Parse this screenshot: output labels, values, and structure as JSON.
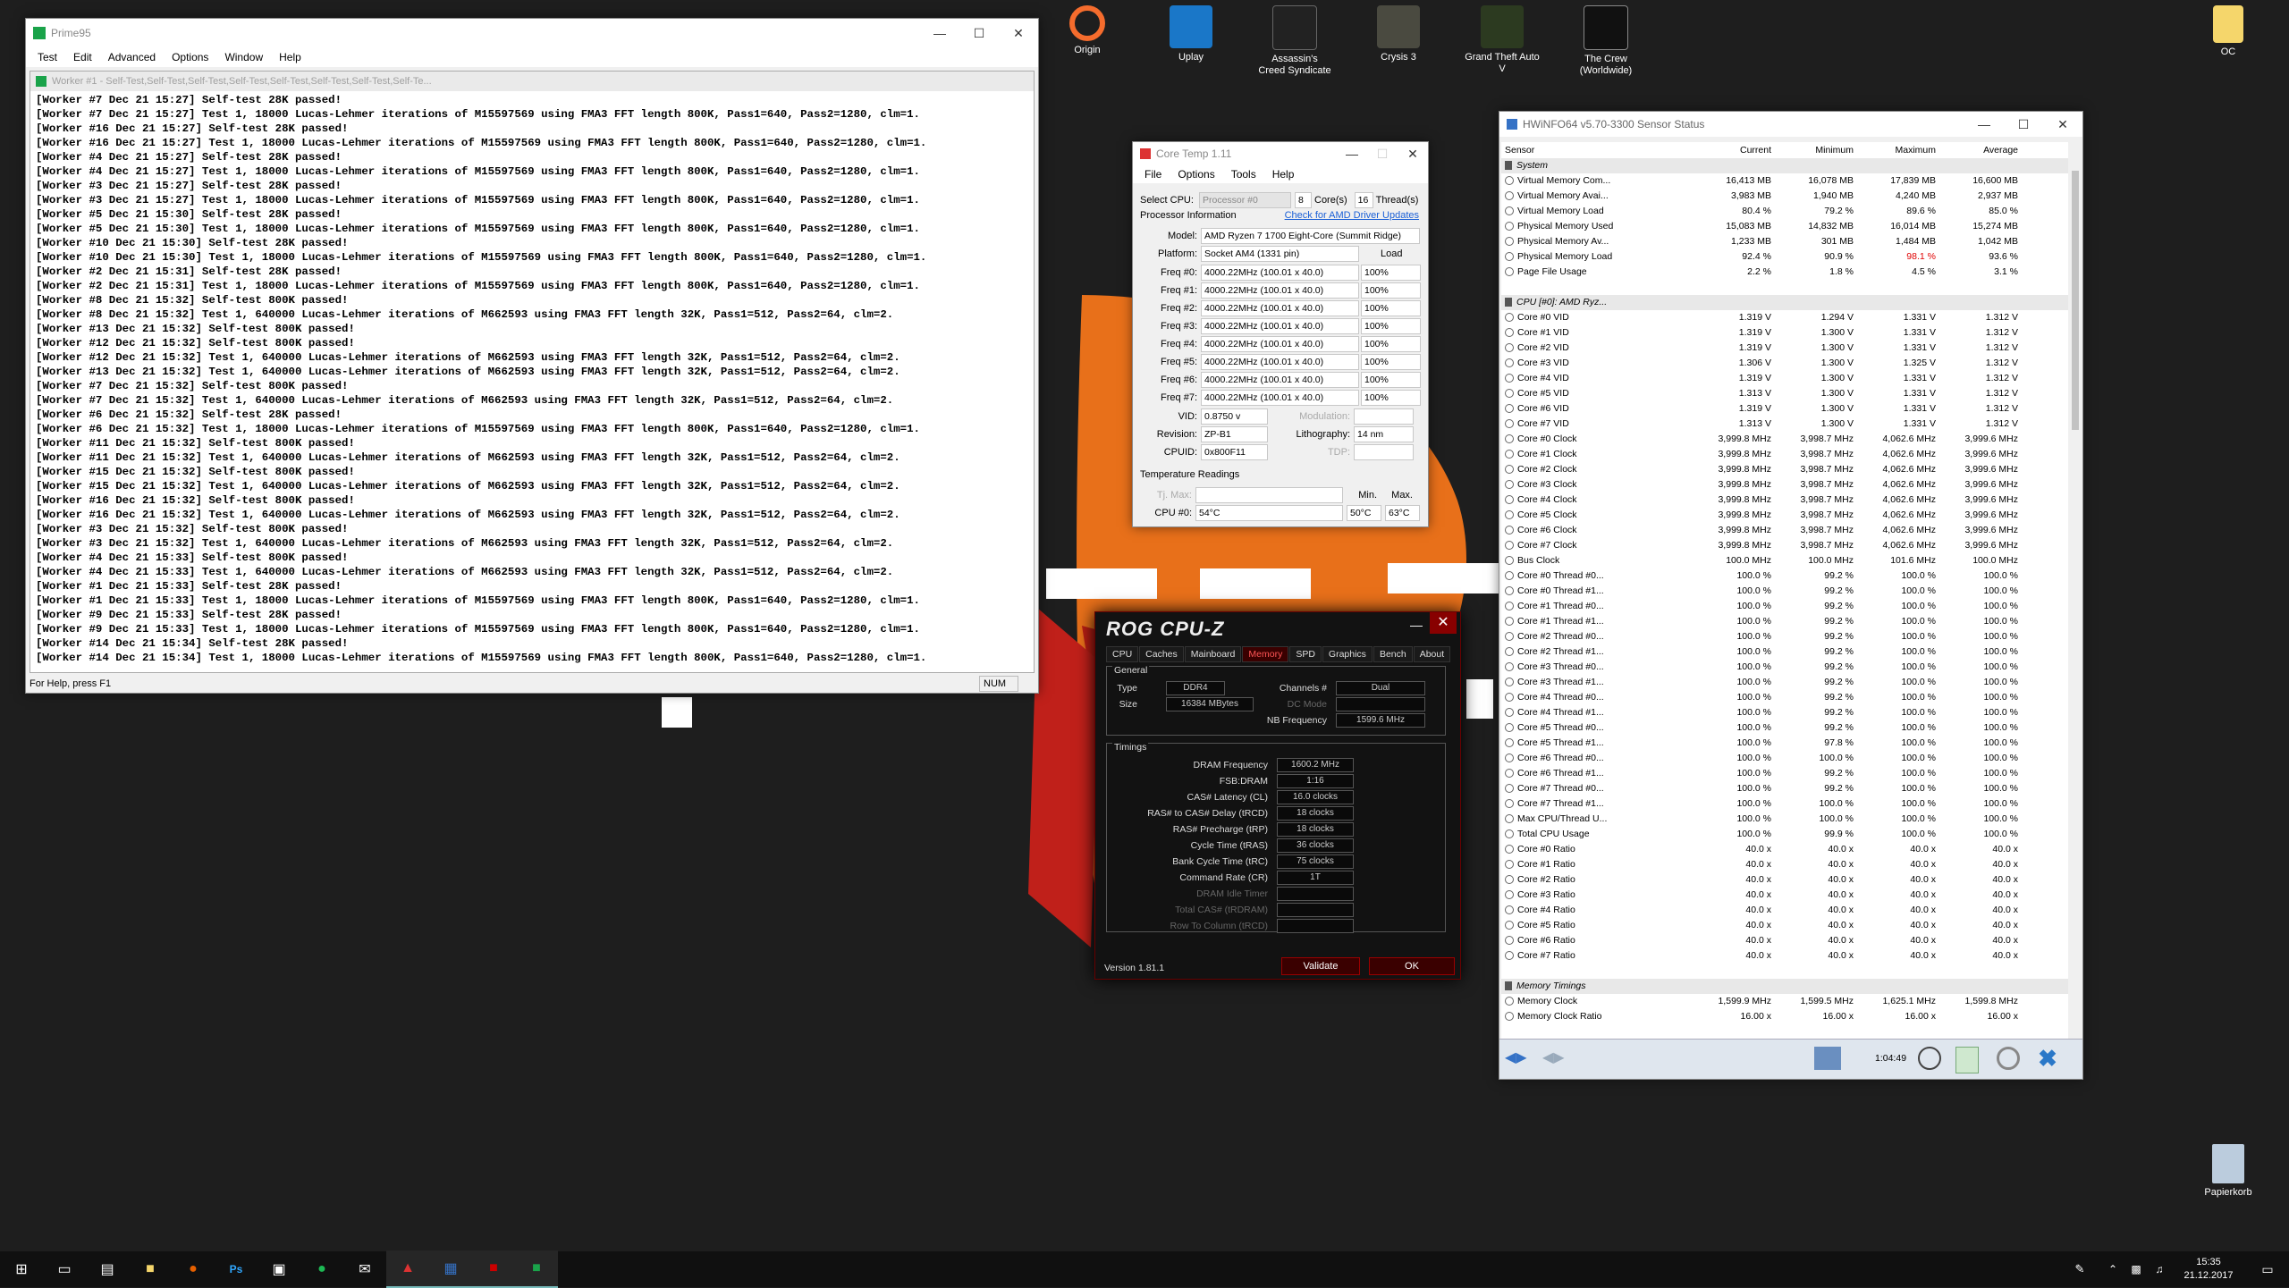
{
  "desktop": {
    "icons": [
      {
        "label": "Origin"
      },
      {
        "label": "Uplay"
      },
      {
        "label": "Assassin's Creed Syndicate"
      },
      {
        "label": "Crysis 3"
      },
      {
        "label": "Grand Theft Auto V"
      },
      {
        "label": "The Crew (Worldwide)"
      },
      {
        "label": "OC"
      },
      {
        "label": "Papierkorb"
      }
    ]
  },
  "prime": {
    "title": "Prime95",
    "menu": [
      "Test",
      "Edit",
      "Advanced",
      "Options",
      "Window",
      "Help"
    ],
    "child_title": "Worker #1 - Self-Test,Self-Test,Self-Test,Self-Test,Self-Test,Self-Test,Self-Test,Self-Te...",
    "log": [
      "[Worker #7 Dec 21 15:27] Self-test 28K passed!",
      "[Worker #7 Dec 21 15:27] Test 1, 18000 Lucas-Lehmer iterations of M15597569 using FMA3 FFT length 800K, Pass1=640, Pass2=1280, clm=1.",
      "[Worker #16 Dec 21 15:27] Self-test 28K passed!",
      "[Worker #16 Dec 21 15:27] Test 1, 18000 Lucas-Lehmer iterations of M15597569 using FMA3 FFT length 800K, Pass1=640, Pass2=1280, clm=1.",
      "[Worker #4 Dec 21 15:27] Self-test 28K passed!",
      "[Worker #4 Dec 21 15:27] Test 1, 18000 Lucas-Lehmer iterations of M15597569 using FMA3 FFT length 800K, Pass1=640, Pass2=1280, clm=1.",
      "[Worker #3 Dec 21 15:27] Self-test 28K passed!",
      "[Worker #3 Dec 21 15:27] Test 1, 18000 Lucas-Lehmer iterations of M15597569 using FMA3 FFT length 800K, Pass1=640, Pass2=1280, clm=1.",
      "[Worker #5 Dec 21 15:30] Self-test 28K passed!",
      "[Worker #5 Dec 21 15:30] Test 1, 18000 Lucas-Lehmer iterations of M15597569 using FMA3 FFT length 800K, Pass1=640, Pass2=1280, clm=1.",
      "[Worker #10 Dec 21 15:30] Self-test 28K passed!",
      "[Worker #10 Dec 21 15:30] Test 1, 18000 Lucas-Lehmer iterations of M15597569 using FMA3 FFT length 800K, Pass1=640, Pass2=1280, clm=1.",
      "[Worker #2 Dec 21 15:31] Self-test 28K passed!",
      "[Worker #2 Dec 21 15:31] Test 1, 18000 Lucas-Lehmer iterations of M15597569 using FMA3 FFT length 800K, Pass1=640, Pass2=1280, clm=1.",
      "[Worker #8 Dec 21 15:32] Self-test 800K passed!",
      "[Worker #8 Dec 21 15:32] Test 1, 640000 Lucas-Lehmer iterations of M662593 using FMA3 FFT length 32K, Pass1=512, Pass2=64, clm=2.",
      "[Worker #13 Dec 21 15:32] Self-test 800K passed!",
      "[Worker #12 Dec 21 15:32] Self-test 800K passed!",
      "[Worker #12 Dec 21 15:32] Test 1, 640000 Lucas-Lehmer iterations of M662593 using FMA3 FFT length 32K, Pass1=512, Pass2=64, clm=2.",
      "[Worker #13 Dec 21 15:32] Test 1, 640000 Lucas-Lehmer iterations of M662593 using FMA3 FFT length 32K, Pass1=512, Pass2=64, clm=2.",
      "[Worker #7 Dec 21 15:32] Self-test 800K passed!",
      "[Worker #7 Dec 21 15:32] Test 1, 640000 Lucas-Lehmer iterations of M662593 using FMA3 FFT length 32K, Pass1=512, Pass2=64, clm=2.",
      "[Worker #6 Dec 21 15:32] Self-test 28K passed!",
      "[Worker #6 Dec 21 15:32] Test 1, 18000 Lucas-Lehmer iterations of M15597569 using FMA3 FFT length 800K, Pass1=640, Pass2=1280, clm=1.",
      "[Worker #11 Dec 21 15:32] Self-test 800K passed!",
      "[Worker #11 Dec 21 15:32] Test 1, 640000 Lucas-Lehmer iterations of M662593 using FMA3 FFT length 32K, Pass1=512, Pass2=64, clm=2.",
      "[Worker #15 Dec 21 15:32] Self-test 800K passed!",
      "[Worker #15 Dec 21 15:32] Test 1, 640000 Lucas-Lehmer iterations of M662593 using FMA3 FFT length 32K, Pass1=512, Pass2=64, clm=2.",
      "[Worker #16 Dec 21 15:32] Self-test 800K passed!",
      "[Worker #16 Dec 21 15:32] Test 1, 640000 Lucas-Lehmer iterations of M662593 using FMA3 FFT length 32K, Pass1=512, Pass2=64, clm=2.",
      "[Worker #3 Dec 21 15:32] Self-test 800K passed!",
      "[Worker #3 Dec 21 15:32] Test 1, 640000 Lucas-Lehmer iterations of M662593 using FMA3 FFT length 32K, Pass1=512, Pass2=64, clm=2.",
      "[Worker #4 Dec 21 15:33] Self-test 800K passed!",
      "[Worker #4 Dec 21 15:33] Test 1, 640000 Lucas-Lehmer iterations of M662593 using FMA3 FFT length 32K, Pass1=512, Pass2=64, clm=2.",
      "[Worker #1 Dec 21 15:33] Self-test 28K passed!",
      "[Worker #1 Dec 21 15:33] Test 1, 18000 Lucas-Lehmer iterations of M15597569 using FMA3 FFT length 800K, Pass1=640, Pass2=1280, clm=1.",
      "[Worker #9 Dec 21 15:33] Self-test 28K passed!",
      "[Worker #9 Dec 21 15:33] Test 1, 18000 Lucas-Lehmer iterations of M15597569 using FMA3 FFT length 800K, Pass1=640, Pass2=1280, clm=1.",
      "[Worker #14 Dec 21 15:34] Self-test 28K passed!",
      "[Worker #14 Dec 21 15:34] Test 1, 18000 Lucas-Lehmer iterations of M15597569 using FMA3 FFT length 800K, Pass1=640, Pass2=1280, clm=1."
    ],
    "status_left": "For Help, press F1",
    "status_num": "NUM"
  },
  "coretemp": {
    "title": "Core Temp 1.11",
    "menu": [
      "File",
      "Options",
      "Tools",
      "Help"
    ],
    "select_cpu_label": "Select CPU:",
    "select_cpu_value": "Processor #0",
    "cores_value": "8",
    "cores_label": "Core(s)",
    "threads_value": "16",
    "threads_label": "Thread(s)",
    "proc_info_label": "Processor Information",
    "driver_link": "Check for AMD Driver Updates",
    "model_label": "Model:",
    "model_value": "AMD Ryzen 7 1700 Eight-Core (Summit Ridge)",
    "platform_label": "Platform:",
    "platform_value": "Socket AM4 (1331 pin)",
    "load_label": "Load",
    "freqs": [
      {
        "label": "Freq #0:",
        "value": "4000.22MHz (100.01 x 40.0)",
        "load": "100%"
      },
      {
        "label": "Freq #1:",
        "value": "4000.22MHz (100.01 x 40.0)",
        "load": "100%"
      },
      {
        "label": "Freq #2:",
        "value": "4000.22MHz (100.01 x 40.0)",
        "load": "100%"
      },
      {
        "label": "Freq #3:",
        "value": "4000.22MHz (100.01 x 40.0)",
        "load": "100%"
      },
      {
        "label": "Freq #4:",
        "value": "4000.22MHz (100.01 x 40.0)",
        "load": "100%"
      },
      {
        "label": "Freq #5:",
        "value": "4000.22MHz (100.01 x 40.0)",
        "load": "100%"
      },
      {
        "label": "Freq #6:",
        "value": "4000.22MHz (100.01 x 40.0)",
        "load": "100%"
      },
      {
        "label": "Freq #7:",
        "value": "4000.22MHz (100.01 x 40.0)",
        "load": "100%"
      }
    ],
    "vid_label": "VID:",
    "vid_value": "0.8750 v",
    "modulation_label": "Modulation:",
    "revision_label": "Revision:",
    "revision_value": "ZP-B1",
    "litho_label": "Lithography:",
    "litho_value": "14 nm",
    "cpuid_label": "CPUID:",
    "cpuid_value": "0x800F11",
    "tdp_label": "TDP:",
    "temp_title": "Temperature Readings",
    "tjmax_label": "Tj. Max:",
    "min_label": "Min.",
    "max_label": "Max.",
    "cpu0_label": "CPU #0:",
    "cpu0_value": "54°C",
    "cpu0_min": "50°C",
    "cpu0_max": "63°C"
  },
  "cpuz": {
    "title": "ROG CPU-Z",
    "tabs": [
      "CPU",
      "Caches",
      "Mainboard",
      "Memory",
      "SPD",
      "Graphics",
      "Bench",
      "About"
    ],
    "selected_tab": "Memory",
    "general_label": "General",
    "type_label": "Type",
    "type_value": "DDR4",
    "size_label": "Size",
    "size_value": "16384 MBytes",
    "channels_label": "Channels #",
    "channels_value": "Dual",
    "dcmode_label": "DC Mode",
    "nbfreq_label": "NB Frequency",
    "nbfreq_value": "1599.6 MHz",
    "timings_label": "Timings",
    "timings": [
      {
        "label": "DRAM Frequency",
        "value": "1600.2 MHz",
        "dim": false
      },
      {
        "label": "FSB:DRAM",
        "value": "1:16",
        "dim": false
      },
      {
        "label": "CAS# Latency (CL)",
        "value": "16.0 clocks",
        "dim": false
      },
      {
        "label": "RAS# to CAS# Delay (tRCD)",
        "value": "18 clocks",
        "dim": false
      },
      {
        "label": "RAS# Precharge (tRP)",
        "value": "18 clocks",
        "dim": false
      },
      {
        "label": "Cycle Time (tRAS)",
        "value": "36 clocks",
        "dim": false
      },
      {
        "label": "Bank Cycle Time (tRC)",
        "value": "75 clocks",
        "dim": false
      },
      {
        "label": "Command Rate (CR)",
        "value": "1T",
        "dim": false
      },
      {
        "label": "DRAM Idle Timer",
        "value": "",
        "dim": true
      },
      {
        "label": "Total CAS# (tRDRAM)",
        "value": "",
        "dim": true
      },
      {
        "label": "Row To Column (tRCD)",
        "value": "",
        "dim": true
      }
    ],
    "version": "Version 1.81.1",
    "validate": "Validate",
    "ok": "OK"
  },
  "hwinfo": {
    "title": "HWiNFO64 v5.70-3300 Sensor Status",
    "headers": [
      "Sensor",
      "Current",
      "Minimum",
      "Maximum",
      "Average"
    ],
    "rows": [
      {
        "group": true,
        "name": "System"
      },
      {
        "name": "Virtual Memory Com...",
        "cur": "16,413 MB",
        "min": "16,078 MB",
        "max": "17,839 MB",
        "avg": "16,600 MB"
      },
      {
        "name": "Virtual Memory Avai...",
        "cur": "3,983 MB",
        "min": "1,940 MB",
        "max": "4,240 MB",
        "avg": "2,937 MB"
      },
      {
        "name": "Virtual Memory Load",
        "cur": "80.4 %",
        "min": "79.2 %",
        "max": "89.6 %",
        "avg": "85.0 %"
      },
      {
        "name": "Physical Memory Used",
        "cur": "15,083 MB",
        "min": "14,832 MB",
        "max": "16,014 MB",
        "avg": "15,274 MB"
      },
      {
        "name": "Physical Memory Av...",
        "cur": "1,233 MB",
        "min": "301 MB",
        "max": "1,484 MB",
        "avg": "1,042 MB"
      },
      {
        "name": "Physical Memory Load",
        "cur": "92.4 %",
        "min": "90.9 %",
        "max": "98.1 %",
        "avg": "93.6 %",
        "red": true
      },
      {
        "name": "Page File Usage",
        "cur": "2.2 %",
        "min": "1.8 %",
        "max": "4.5 %",
        "avg": "3.1 %"
      },
      {
        "blank": true
      },
      {
        "group": true,
        "name": "CPU [#0]: AMD Ryz..."
      },
      {
        "name": "Core #0 VID",
        "cur": "1.319 V",
        "min": "1.294 V",
        "max": "1.331 V",
        "avg": "1.312 V"
      },
      {
        "name": "Core #1 VID",
        "cur": "1.319 V",
        "min": "1.300 V",
        "max": "1.331 V",
        "avg": "1.312 V"
      },
      {
        "name": "Core #2 VID",
        "cur": "1.319 V",
        "min": "1.300 V",
        "max": "1.331 V",
        "avg": "1.312 V"
      },
      {
        "name": "Core #3 VID",
        "cur": "1.306 V",
        "min": "1.300 V",
        "max": "1.325 V",
        "avg": "1.312 V"
      },
      {
        "name": "Core #4 VID",
        "cur": "1.319 V",
        "min": "1.300 V",
        "max": "1.331 V",
        "avg": "1.312 V"
      },
      {
        "name": "Core #5 VID",
        "cur": "1.313 V",
        "min": "1.300 V",
        "max": "1.331 V",
        "avg": "1.312 V"
      },
      {
        "name": "Core #6 VID",
        "cur": "1.319 V",
        "min": "1.300 V",
        "max": "1.331 V",
        "avg": "1.312 V"
      },
      {
        "name": "Core #7 VID",
        "cur": "1.313 V",
        "min": "1.300 V",
        "max": "1.331 V",
        "avg": "1.312 V"
      },
      {
        "name": "Core #0 Clock",
        "cur": "3,999.8 MHz",
        "min": "3,998.7 MHz",
        "max": "4,062.6 MHz",
        "avg": "3,999.6 MHz"
      },
      {
        "name": "Core #1 Clock",
        "cur": "3,999.8 MHz",
        "min": "3,998.7 MHz",
        "max": "4,062.6 MHz",
        "avg": "3,999.6 MHz"
      },
      {
        "name": "Core #2 Clock",
        "cur": "3,999.8 MHz",
        "min": "3,998.7 MHz",
        "max": "4,062.6 MHz",
        "avg": "3,999.6 MHz"
      },
      {
        "name": "Core #3 Clock",
        "cur": "3,999.8 MHz",
        "min": "3,998.7 MHz",
        "max": "4,062.6 MHz",
        "avg": "3,999.6 MHz"
      },
      {
        "name": "Core #4 Clock",
        "cur": "3,999.8 MHz",
        "min": "3,998.7 MHz",
        "max": "4,062.6 MHz",
        "avg": "3,999.6 MHz"
      },
      {
        "name": "Core #5 Clock",
        "cur": "3,999.8 MHz",
        "min": "3,998.7 MHz",
        "max": "4,062.6 MHz",
        "avg": "3,999.6 MHz"
      },
      {
        "name": "Core #6 Clock",
        "cur": "3,999.8 MHz",
        "min": "3,998.7 MHz",
        "max": "4,062.6 MHz",
        "avg": "3,999.6 MHz"
      },
      {
        "name": "Core #7 Clock",
        "cur": "3,999.8 MHz",
        "min": "3,998.7 MHz",
        "max": "4,062.6 MHz",
        "avg": "3,999.6 MHz"
      },
      {
        "name": "Bus Clock",
        "cur": "100.0 MHz",
        "min": "100.0 MHz",
        "max": "101.6 MHz",
        "avg": "100.0 MHz"
      },
      {
        "name": "Core #0 Thread #0...",
        "cur": "100.0 %",
        "min": "99.2 %",
        "max": "100.0 %",
        "avg": "100.0 %"
      },
      {
        "name": "Core #0 Thread #1...",
        "cur": "100.0 %",
        "min": "99.2 %",
        "max": "100.0 %",
        "avg": "100.0 %"
      },
      {
        "name": "Core #1 Thread #0...",
        "cur": "100.0 %",
        "min": "99.2 %",
        "max": "100.0 %",
        "avg": "100.0 %"
      },
      {
        "name": "Core #1 Thread #1...",
        "cur": "100.0 %",
        "min": "99.2 %",
        "max": "100.0 %",
        "avg": "100.0 %"
      },
      {
        "name": "Core #2 Thread #0...",
        "cur": "100.0 %",
        "min": "99.2 %",
        "max": "100.0 %",
        "avg": "100.0 %"
      },
      {
        "name": "Core #2 Thread #1...",
        "cur": "100.0 %",
        "min": "99.2 %",
        "max": "100.0 %",
        "avg": "100.0 %"
      },
      {
        "name": "Core #3 Thread #0...",
        "cur": "100.0 %",
        "min": "99.2 %",
        "max": "100.0 %",
        "avg": "100.0 %"
      },
      {
        "name": "Core #3 Thread #1...",
        "cur": "100.0 %",
        "min": "99.2 %",
        "max": "100.0 %",
        "avg": "100.0 %"
      },
      {
        "name": "Core #4 Thread #0...",
        "cur": "100.0 %",
        "min": "99.2 %",
        "max": "100.0 %",
        "avg": "100.0 %"
      },
      {
        "name": "Core #4 Thread #1...",
        "cur": "100.0 %",
        "min": "99.2 %",
        "max": "100.0 %",
        "avg": "100.0 %"
      },
      {
        "name": "Core #5 Thread #0...",
        "cur": "100.0 %",
        "min": "99.2 %",
        "max": "100.0 %",
        "avg": "100.0 %"
      },
      {
        "name": "Core #5 Thread #1...",
        "cur": "100.0 %",
        "min": "97.8 %",
        "max": "100.0 %",
        "avg": "100.0 %"
      },
      {
        "name": "Core #6 Thread #0...",
        "cur": "100.0 %",
        "min": "100.0 %",
        "max": "100.0 %",
        "avg": "100.0 %"
      },
      {
        "name": "Core #6 Thread #1...",
        "cur": "100.0 %",
        "min": "99.2 %",
        "max": "100.0 %",
        "avg": "100.0 %"
      },
      {
        "name": "Core #7 Thread #0...",
        "cur": "100.0 %",
        "min": "99.2 %",
        "max": "100.0 %",
        "avg": "100.0 %"
      },
      {
        "name": "Core #7 Thread #1...",
        "cur": "100.0 %",
        "min": "100.0 %",
        "max": "100.0 %",
        "avg": "100.0 %"
      },
      {
        "name": "Max CPU/Thread U...",
        "cur": "100.0 %",
        "min": "100.0 %",
        "max": "100.0 %",
        "avg": "100.0 %"
      },
      {
        "name": "Total CPU Usage",
        "cur": "100.0 %",
        "min": "99.9 %",
        "max": "100.0 %",
        "avg": "100.0 %"
      },
      {
        "name": "Core #0 Ratio",
        "cur": "40.0 x",
        "min": "40.0 x",
        "max": "40.0 x",
        "avg": "40.0 x"
      },
      {
        "name": "Core #1 Ratio",
        "cur": "40.0 x",
        "min": "40.0 x",
        "max": "40.0 x",
        "avg": "40.0 x"
      },
      {
        "name": "Core #2 Ratio",
        "cur": "40.0 x",
        "min": "40.0 x",
        "max": "40.0 x",
        "avg": "40.0 x"
      },
      {
        "name": "Core #3 Ratio",
        "cur": "40.0 x",
        "min": "40.0 x",
        "max": "40.0 x",
        "avg": "40.0 x"
      },
      {
        "name": "Core #4 Ratio",
        "cur": "40.0 x",
        "min": "40.0 x",
        "max": "40.0 x",
        "avg": "40.0 x"
      },
      {
        "name": "Core #5 Ratio",
        "cur": "40.0 x",
        "min": "40.0 x",
        "max": "40.0 x",
        "avg": "40.0 x"
      },
      {
        "name": "Core #6 Ratio",
        "cur": "40.0 x",
        "min": "40.0 x",
        "max": "40.0 x",
        "avg": "40.0 x"
      },
      {
        "name": "Core #7 Ratio",
        "cur": "40.0 x",
        "min": "40.0 x",
        "max": "40.0 x",
        "avg": "40.0 x"
      },
      {
        "blank": true
      },
      {
        "group": true,
        "name": "Memory Timings"
      },
      {
        "name": "Memory Clock",
        "cur": "1,599.9 MHz",
        "min": "1,599.5 MHz",
        "max": "1,625.1 MHz",
        "avg": "1,599.8 MHz"
      },
      {
        "name": "Memory Clock Ratio",
        "cur": "16.00 x",
        "min": "16.00 x",
        "max": "16.00 x",
        "avg": "16.00 x"
      }
    ],
    "elapsed": "1:04:49"
  },
  "taskbar": {
    "time": "15:35",
    "date": "21.12.2017"
  },
  "colors": {
    "ryzen_orange": "#e8701a",
    "ryzen_red": "#c0201a",
    "rog_red": "#c00000",
    "warn_red": "#e00000"
  }
}
